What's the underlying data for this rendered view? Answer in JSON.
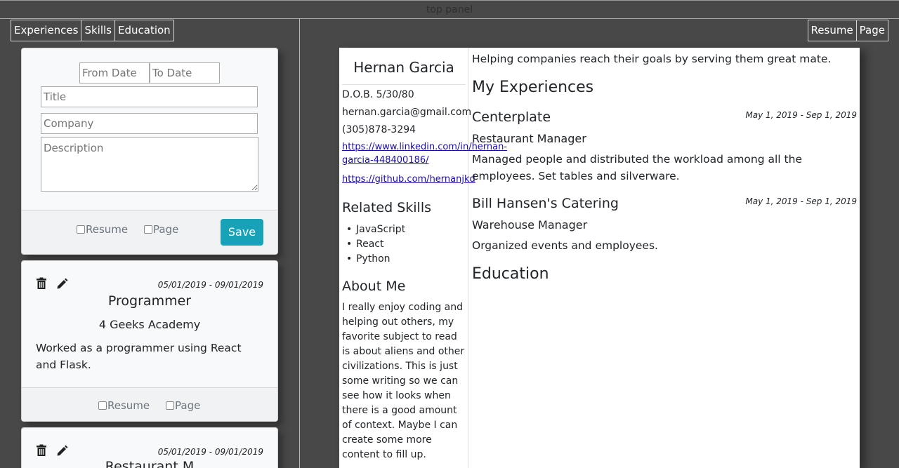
{
  "top_panel": {
    "label": "top panel"
  },
  "left_tabs": [
    {
      "label": "Experiences"
    },
    {
      "label": "Skills"
    },
    {
      "label": "Education"
    }
  ],
  "right_tabs": [
    {
      "label": "Resume"
    },
    {
      "label": "Page"
    }
  ],
  "form": {
    "from_date_placeholder": "From Date",
    "to_date_placeholder": "To Date",
    "title_placeholder": "Title",
    "company_placeholder": "Company",
    "description_placeholder": "Description",
    "resume_label": "Resume",
    "page_label": "Page",
    "save_label": "Save"
  },
  "experience_cards": [
    {
      "date_range": "05/01/2019 - 09/01/2019",
      "title": "Programmer",
      "company": "4 Geeks Academy",
      "description": "Worked as a programmer using React and Flask.",
      "resume_label": "Resume",
      "page_label": "Page"
    },
    {
      "date_range": "05/01/2019 - 09/01/2019",
      "title": "Restaurant M"
    }
  ],
  "resume": {
    "name": "Hernan Garcia",
    "dob": "D.O.B. 5/30/80",
    "email": "hernan.garcia@gmail.com",
    "phone": "(305)878-3294",
    "linkedin": "https://www.linkedin.com/in/hernan-garcia-448400186/",
    "github": "https://github.com/hernanjkd",
    "skills_heading": "Related Skills",
    "skills": [
      "JavaScript",
      "React",
      "Python"
    ],
    "about_heading": "About Me",
    "about_text": "I really enjoy coding and helping out others, my favorite subject to read is about aliens and other civilizations. This is just some writing so we can see how it looks when there is a good amount of context. Maybe I can create some more content to fill up.",
    "summary": "Helping companies reach their goals by serving them great mate.",
    "experiences_heading": "My Experiences",
    "experiences": [
      {
        "company": "Centerplate",
        "date_range": "May 1, 2019 - Sep 1, 2019",
        "position": "Restaurant Manager",
        "description": "Managed people and distributed the workload among all the employees. Set tables and silverware."
      },
      {
        "company": "Bill Hansen's Catering",
        "date_range": "May 1, 2019 - Sep 1, 2019",
        "position": "Warehouse Manager",
        "description": "Organized events and employees."
      }
    ],
    "education_heading": "Education"
  }
}
